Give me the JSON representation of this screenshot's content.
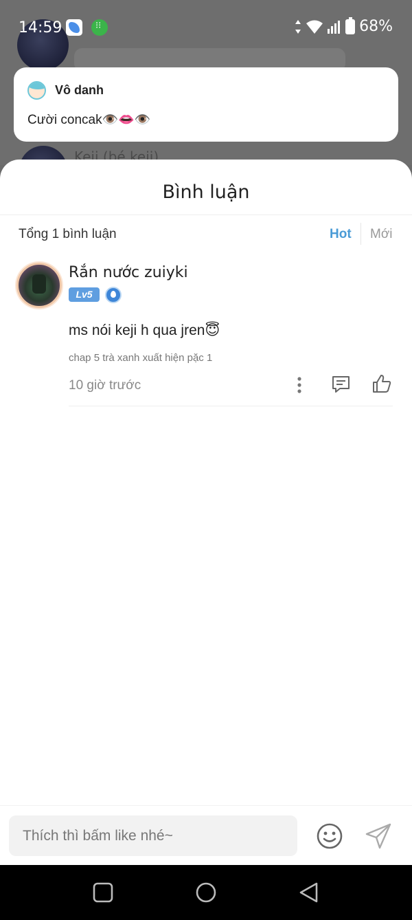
{
  "status_bar": {
    "time": "14:59",
    "battery": "68%"
  },
  "notification": {
    "name": "Vô danh",
    "message": "Cười concak👁️👄👁️"
  },
  "background": {
    "partial_name": "Keji (bé keji)"
  },
  "sheet": {
    "title": "Bình luận",
    "total": "Tổng 1 bình luận",
    "sort_hot": "Hot",
    "sort_new": "Mới"
  },
  "comment": {
    "author": "Rắn nước zuiyki",
    "level": "Lv5",
    "text": "ms nói keji h qua jren😇",
    "chapter": "chap 5 trà xanh xuất hiện pặc 1",
    "time": "10 giờ trước"
  },
  "input": {
    "placeholder": "Thích thì bấm like nhé~"
  },
  "colors": {
    "accent": "#4a9bd6",
    "level_badge": "#5f9ee0"
  }
}
